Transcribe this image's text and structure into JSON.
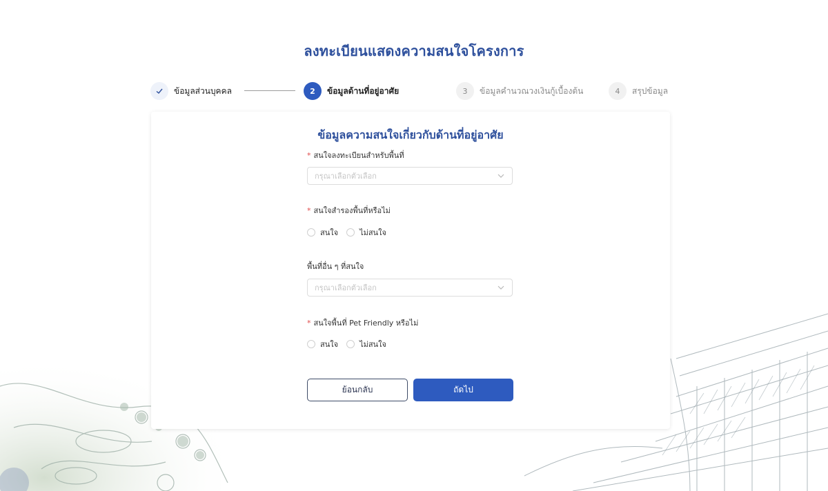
{
  "page_title": "ลงทะเบียนแสดงความสนใจโครงการ",
  "stepper": {
    "steps": [
      {
        "label": "ข้อมูลส่วนบุคคล",
        "state": "done",
        "icon": "check-icon",
        "number": ""
      },
      {
        "label": "ข้อมูลด้านที่อยู่อาศัย",
        "state": "active",
        "number": "2"
      },
      {
        "label": "ข้อมูลคำนวณวงเงินกู้เบื้องต้น",
        "state": "todo",
        "number": "3"
      },
      {
        "label": "สรุปข้อมูล",
        "state": "todo",
        "number": "4"
      }
    ]
  },
  "form": {
    "section_title": "ข้อมูลความสนใจเกี่ยวกับด้านที่อยู่อาศัย",
    "fields": {
      "area": {
        "label": "สนใจลงทะเบียนสำหรับพื้นที่",
        "required": true,
        "placeholder": "กรุณาเลือกตัวเลือก"
      },
      "reserve": {
        "label": "สนใจสำรองพื้นที่หรือไม่",
        "required": true,
        "options": [
          "สนใจ",
          "ไม่สนใจ"
        ]
      },
      "other_area": {
        "label": "พื้นที่อื่น ๆ ที่สนใจ",
        "required": false,
        "placeholder": "กรุณาเลือกตัวเลือก"
      },
      "pet": {
        "label": "สนใจพื้นที่ Pet Friendly หรือไม่",
        "required": true,
        "options": [
          "สนใจ",
          "ไม่สนใจ"
        ]
      }
    },
    "required_mark": "*",
    "buttons": {
      "back": "ย้อนกลับ",
      "next": "ถัดไป"
    }
  },
  "colors": {
    "primary": "#2e5bbf",
    "title": "#2d4f9c",
    "required": "#e04b4b"
  }
}
